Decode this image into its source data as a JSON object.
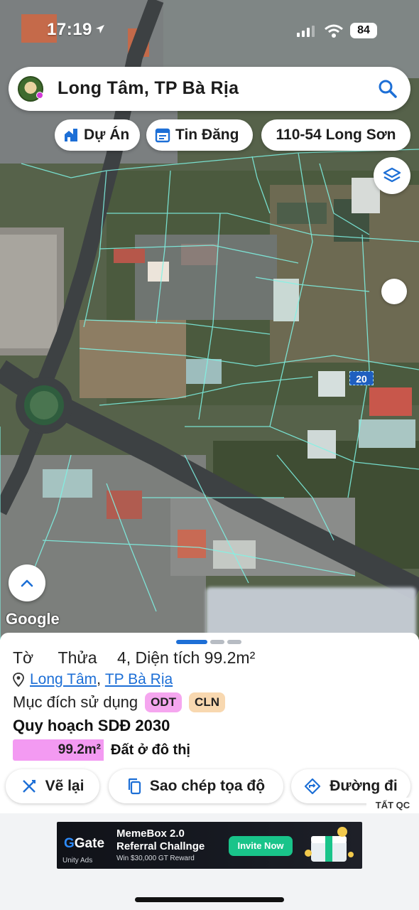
{
  "status_bar": {
    "time": "17:19",
    "battery": "84"
  },
  "search": {
    "title": "Long Tâm, TP Bà Rịa",
    "icon": "search-icon"
  },
  "chips": {
    "du_an": "Dự Án",
    "tin_dang": "Tin Đăng",
    "address": "110-54 Long Sơn"
  },
  "map": {
    "attribution": "Google",
    "parcel_label": "20"
  },
  "parcel": {
    "to_label": "Tờ",
    "thua_label": "Thửa",
    "thua_partial": "4",
    "area_text": ", Diện tích 99.2m²",
    "ward": "Long Tâm",
    "separator": ", ",
    "city": "TP Bà Rịa",
    "purpose_label": "Mục đích sử dụng",
    "purpose_tags": [
      "ODT",
      "CLN"
    ],
    "planning_title": "Quy hoạch SDĐ 2030",
    "planning_area": "99.2m²",
    "planning_type": "Đất ở đô thị"
  },
  "actions": {
    "redraw": "Vẽ lại",
    "copy_coords": "Sao chép tọa độ",
    "directions": "Đường đi"
  },
  "ad": {
    "badge": "TẤT QC",
    "brand": "Gate",
    "network": "Unity Ads",
    "headline_1": "MemeBox 2.0",
    "headline_2": "Referral Challnge",
    "subline": "Win $30,000 GT Reward",
    "cta": "Invite Now"
  },
  "colors": {
    "accent": "#1d6fd6",
    "parcel_lines": "#7ff5e6",
    "odt_tag": "#f5a6ef",
    "cln_tag": "#f8d8b0",
    "ad_cta": "#19c48a"
  }
}
